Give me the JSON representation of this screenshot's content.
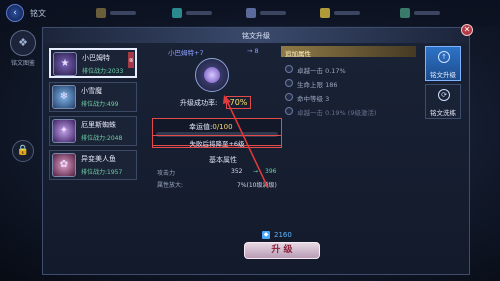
{
  "topbar": {
    "back_icon": "back-icon",
    "title": "铭文"
  },
  "leftnav": {
    "item_label": "铭文图鉴"
  },
  "dialog": {
    "title": "铭文升级",
    "close_icon": "close-icon"
  },
  "heroes": [
    {
      "name": "小巴姆特",
      "power_label": "排位战力:",
      "power": "2033",
      "tag": "强",
      "selected": true
    },
    {
      "name": "小雪魔",
      "power_label": "排位战力:",
      "power": "499",
      "tag": "",
      "selected": false
    },
    {
      "name": "厄里斯蜘蛛",
      "power_label": "排位战力:",
      "power": "2048",
      "tag": "",
      "selected": false
    },
    {
      "name": "异变美人鱼",
      "power_label": "排位战力:",
      "power": "1957",
      "tag": "",
      "selected": false
    }
  ],
  "upgrade": {
    "from_label": "小巴姆特+7",
    "arrow": "→",
    "to_label": "8",
    "success_label": "升级成功率:",
    "success_value": "70%",
    "luck_label": "幸运值:",
    "luck_value": "0/100",
    "fail_text": "失败后将降至+6级"
  },
  "base_attrs": {
    "title": "基本属性",
    "rows": [
      {
        "name": "攻击力",
        "current": "352",
        "arrow": "→",
        "next": "396"
      },
      {
        "name": "属性放大:",
        "value": "7%(10级满级)"
      }
    ]
  },
  "extra_attrs": {
    "title": "追加属性",
    "items": [
      {
        "text": "卓越一击 0.17%",
        "dim": false
      },
      {
        "text": "生命上限 186",
        "dim": false
      },
      {
        "text": "命中等级 3",
        "dim": false
      },
      {
        "text": "卓越一击 0.19% (9级激活)",
        "dim": true
      }
    ]
  },
  "cost": {
    "icon": "gem-icon",
    "value": "2160"
  },
  "button": {
    "label": "升 级"
  },
  "tabs": [
    {
      "label": "铭文升级",
      "active": true
    },
    {
      "label": "铭文洗练",
      "active": false
    }
  ]
}
